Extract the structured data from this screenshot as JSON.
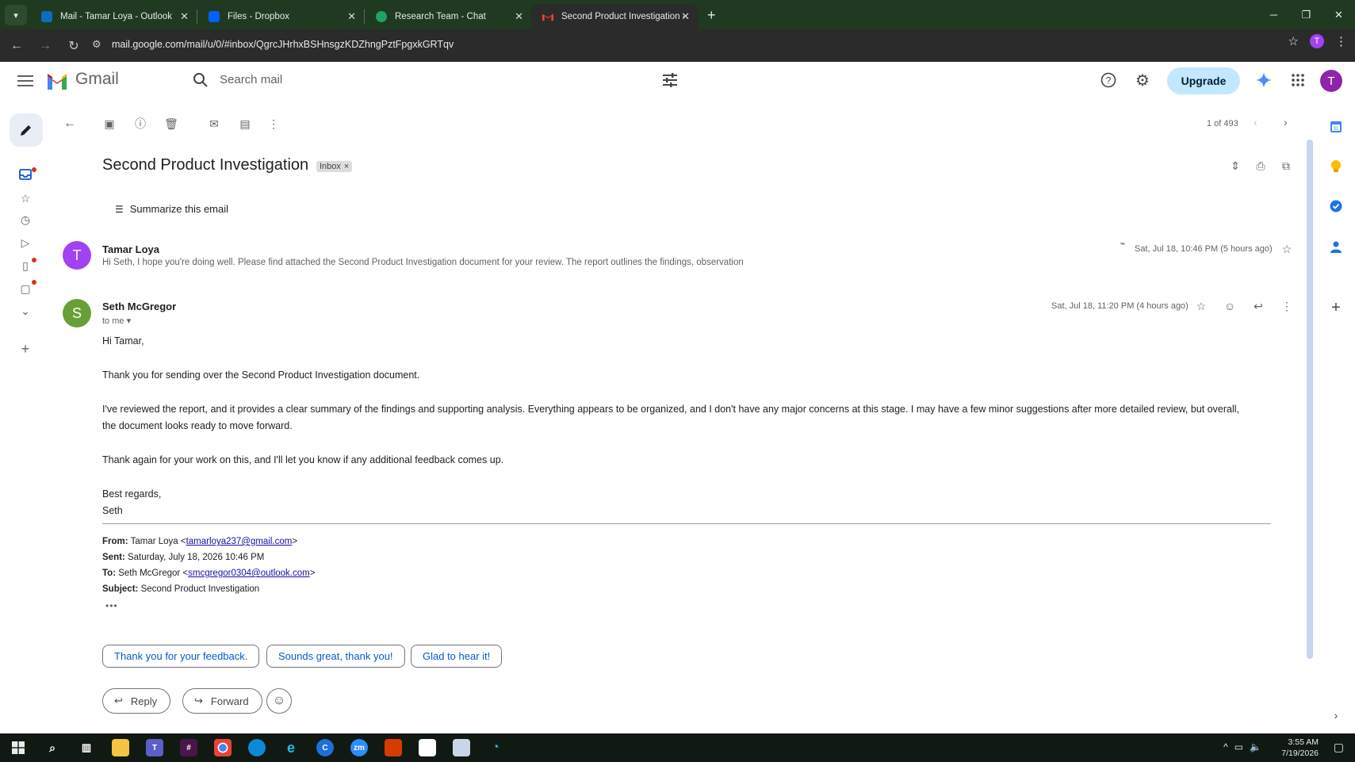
{
  "browser": {
    "tabs": [
      {
        "title": "Mail - Tamar Loya - Outlook",
        "favicon": "outlook-icon",
        "color": "#0f6cbd"
      },
      {
        "title": "Files - Dropbox",
        "favicon": "dropbox-icon",
        "color": "#0061fe"
      },
      {
        "title": "Research Team - Chat",
        "favicon": "google-chat-icon",
        "color": "#1ea362"
      },
      {
        "title": "Second Product Investigation -",
        "favicon": "gmail-icon",
        "color": "#ea4335",
        "active": true
      }
    ],
    "url": "mail.google.com/mail/u/0/#inbox/QgrcJHrhxBSHnsgzKDZhngPztFpgxkGRTqv",
    "profile_initial": "T"
  },
  "gmail": {
    "brand": "Gmail",
    "search_placeholder": "Search mail",
    "upgrade_label": "Upgrade",
    "account_initial": "T"
  },
  "toolbar": {
    "pager": "1 of 493"
  },
  "thread": {
    "subject": "Second Product Investigation",
    "label": "Inbox",
    "label_remove": "×",
    "summarize_label": "Summarize this email",
    "messages": [
      {
        "sender": "Tamar Loya",
        "initial": "T",
        "avatar_color": "#a142f4",
        "date": "Sat, Jul 18, 10:46 PM (5 hours ago)",
        "snippet": "Hi Seth, I hope you're doing well. Please find attached the Second Product Investigation document for your review. The report outlines the findings, observation"
      },
      {
        "sender": "Seth McGregor",
        "initial": "S",
        "avatar_color": "#689f38",
        "date": "Sat, Jul 18, 11:20 PM (4 hours ago)",
        "to": "to me",
        "body": {
          "greeting": "Hi Tamar,",
          "p1": "Thank you for sending over the Second Product Investigation document.",
          "p2_line1": "I've reviewed the report, and it provides a clear summary of the findings and supporting analysis. Everything appears to be organized, and I don't have any major concerns at this stage. I may have a few minor suggestions after more detailed review, but overall,",
          "p2_line2": "the document looks ready to move forward.",
          "p3": "Thank again for your work on this,  and I'll let you know if any additional feedback comes up.",
          "closing": "Best regards,",
          "signature": "Seth"
        },
        "quoted": {
          "from_label": "From:",
          "from_name": "Tamar Loya <",
          "from_email": "tamarloya237@gmail.com",
          "from_end": ">",
          "sent_label": "Sent:",
          "sent_value": "Saturday, July 18, 2026 10:46 PM",
          "to_label": "To:",
          "to_name": "Seth McGregor <",
          "to_email": "smcgregor0304@outlook.com",
          "to_end": ">",
          "subject_label": "Subject:",
          "subject_value": "Second Product Investigation"
        }
      }
    ],
    "smart_replies": [
      "Thank you for your feedback.",
      "Sounds great, thank you!",
      "Glad to hear it!"
    ],
    "reply_label": "Reply",
    "forward_label": "Forward"
  },
  "taskbar": {
    "time": "3:55 AM",
    "date": "7/19/2026"
  }
}
